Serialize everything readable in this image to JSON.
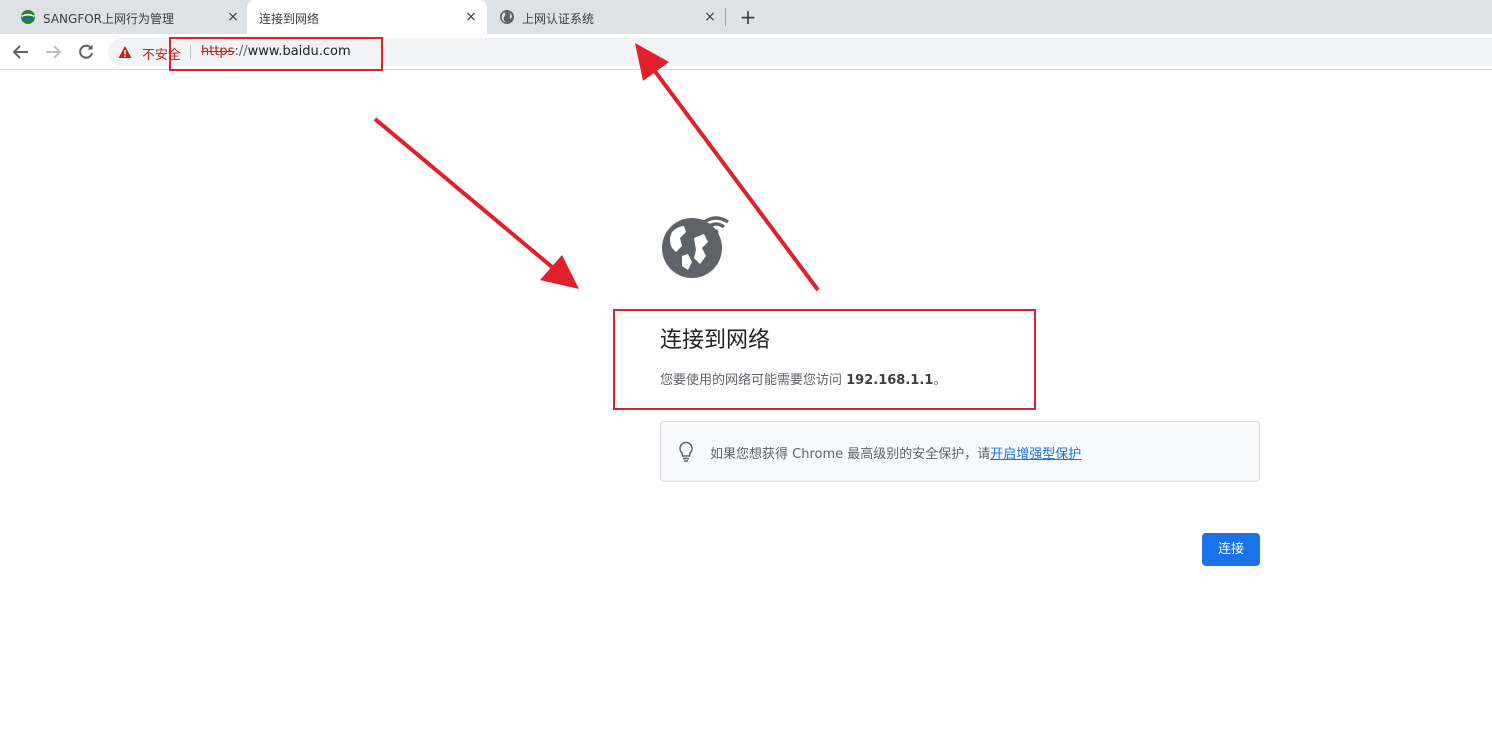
{
  "browser": {
    "tabs": [
      {
        "title": "SANGFOR上网行为管理",
        "favicon": "sangfor-logo-icon",
        "active": false
      },
      {
        "title": "连接到网络",
        "favicon": "",
        "active": true
      },
      {
        "title": "上网认证系统",
        "favicon": "globe-icon",
        "active": false
      }
    ],
    "new_tab_label": "+",
    "close_label": "×",
    "security_label": "不安全",
    "url_scheme": "https",
    "url_separator": "://",
    "url_host": "www.baidu.com"
  },
  "page": {
    "heading": "连接到网络",
    "message_prefix": "您要使用的网络可能需要您访问 ",
    "message_ip": "192.168.1.1",
    "message_suffix": "。",
    "tip_text": "如果您想获得 Chrome 最高级别的安全保护，请",
    "tip_link": "开启增强型保护",
    "connect_button": "连接"
  },
  "colors": {
    "annotation": "#e0202a",
    "button": "#1a73e8",
    "link": "#1a73e8",
    "insecure": "#c5221f"
  }
}
